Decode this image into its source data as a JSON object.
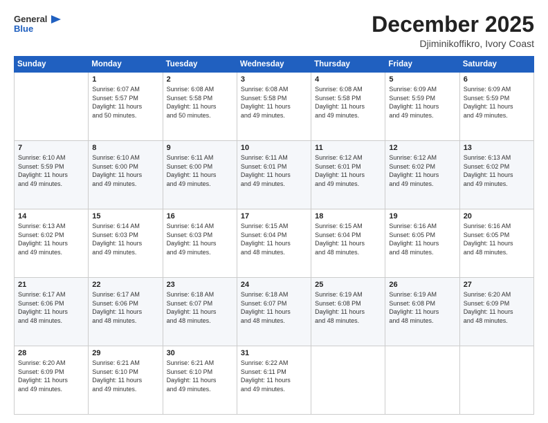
{
  "header": {
    "logo_general": "General",
    "logo_blue": "Blue",
    "month_title": "December 2025",
    "location": "Djiminikoffikro, Ivory Coast"
  },
  "days_of_week": [
    "Sunday",
    "Monday",
    "Tuesday",
    "Wednesday",
    "Thursday",
    "Friday",
    "Saturday"
  ],
  "weeks": [
    [
      {
        "day": "",
        "content": ""
      },
      {
        "day": "1",
        "content": "Sunrise: 6:07 AM\nSunset: 5:57 PM\nDaylight: 11 hours\nand 50 minutes."
      },
      {
        "day": "2",
        "content": "Sunrise: 6:08 AM\nSunset: 5:58 PM\nDaylight: 11 hours\nand 50 minutes."
      },
      {
        "day": "3",
        "content": "Sunrise: 6:08 AM\nSunset: 5:58 PM\nDaylight: 11 hours\nand 49 minutes."
      },
      {
        "day": "4",
        "content": "Sunrise: 6:08 AM\nSunset: 5:58 PM\nDaylight: 11 hours\nand 49 minutes."
      },
      {
        "day": "5",
        "content": "Sunrise: 6:09 AM\nSunset: 5:59 PM\nDaylight: 11 hours\nand 49 minutes."
      },
      {
        "day": "6",
        "content": "Sunrise: 6:09 AM\nSunset: 5:59 PM\nDaylight: 11 hours\nand 49 minutes."
      }
    ],
    [
      {
        "day": "7",
        "content": "Sunrise: 6:10 AM\nSunset: 5:59 PM\nDaylight: 11 hours\nand 49 minutes."
      },
      {
        "day": "8",
        "content": "Sunrise: 6:10 AM\nSunset: 6:00 PM\nDaylight: 11 hours\nand 49 minutes."
      },
      {
        "day": "9",
        "content": "Sunrise: 6:11 AM\nSunset: 6:00 PM\nDaylight: 11 hours\nand 49 minutes."
      },
      {
        "day": "10",
        "content": "Sunrise: 6:11 AM\nSunset: 6:01 PM\nDaylight: 11 hours\nand 49 minutes."
      },
      {
        "day": "11",
        "content": "Sunrise: 6:12 AM\nSunset: 6:01 PM\nDaylight: 11 hours\nand 49 minutes."
      },
      {
        "day": "12",
        "content": "Sunrise: 6:12 AM\nSunset: 6:02 PM\nDaylight: 11 hours\nand 49 minutes."
      },
      {
        "day": "13",
        "content": "Sunrise: 6:13 AM\nSunset: 6:02 PM\nDaylight: 11 hours\nand 49 minutes."
      }
    ],
    [
      {
        "day": "14",
        "content": "Sunrise: 6:13 AM\nSunset: 6:02 PM\nDaylight: 11 hours\nand 49 minutes."
      },
      {
        "day": "15",
        "content": "Sunrise: 6:14 AM\nSunset: 6:03 PM\nDaylight: 11 hours\nand 49 minutes."
      },
      {
        "day": "16",
        "content": "Sunrise: 6:14 AM\nSunset: 6:03 PM\nDaylight: 11 hours\nand 49 minutes."
      },
      {
        "day": "17",
        "content": "Sunrise: 6:15 AM\nSunset: 6:04 PM\nDaylight: 11 hours\nand 48 minutes."
      },
      {
        "day": "18",
        "content": "Sunrise: 6:15 AM\nSunset: 6:04 PM\nDaylight: 11 hours\nand 48 minutes."
      },
      {
        "day": "19",
        "content": "Sunrise: 6:16 AM\nSunset: 6:05 PM\nDaylight: 11 hours\nand 48 minutes."
      },
      {
        "day": "20",
        "content": "Sunrise: 6:16 AM\nSunset: 6:05 PM\nDaylight: 11 hours\nand 48 minutes."
      }
    ],
    [
      {
        "day": "21",
        "content": "Sunrise: 6:17 AM\nSunset: 6:06 PM\nDaylight: 11 hours\nand 48 minutes."
      },
      {
        "day": "22",
        "content": "Sunrise: 6:17 AM\nSunset: 6:06 PM\nDaylight: 11 hours\nand 48 minutes."
      },
      {
        "day": "23",
        "content": "Sunrise: 6:18 AM\nSunset: 6:07 PM\nDaylight: 11 hours\nand 48 minutes."
      },
      {
        "day": "24",
        "content": "Sunrise: 6:18 AM\nSunset: 6:07 PM\nDaylight: 11 hours\nand 48 minutes."
      },
      {
        "day": "25",
        "content": "Sunrise: 6:19 AM\nSunset: 6:08 PM\nDaylight: 11 hours\nand 48 minutes."
      },
      {
        "day": "26",
        "content": "Sunrise: 6:19 AM\nSunset: 6:08 PM\nDaylight: 11 hours\nand 48 minutes."
      },
      {
        "day": "27",
        "content": "Sunrise: 6:20 AM\nSunset: 6:09 PM\nDaylight: 11 hours\nand 48 minutes."
      }
    ],
    [
      {
        "day": "28",
        "content": "Sunrise: 6:20 AM\nSunset: 6:09 PM\nDaylight: 11 hours\nand 49 minutes."
      },
      {
        "day": "29",
        "content": "Sunrise: 6:21 AM\nSunset: 6:10 PM\nDaylight: 11 hours\nand 49 minutes."
      },
      {
        "day": "30",
        "content": "Sunrise: 6:21 AM\nSunset: 6:10 PM\nDaylight: 11 hours\nand 49 minutes."
      },
      {
        "day": "31",
        "content": "Sunrise: 6:22 AM\nSunset: 6:11 PM\nDaylight: 11 hours\nand 49 minutes."
      },
      {
        "day": "",
        "content": ""
      },
      {
        "day": "",
        "content": ""
      },
      {
        "day": "",
        "content": ""
      }
    ]
  ]
}
